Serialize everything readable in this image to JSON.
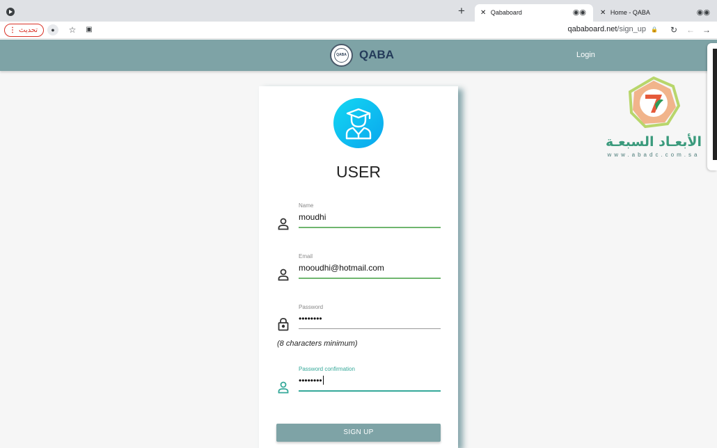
{
  "browser": {
    "new_tab_label": "+",
    "tabs": [
      {
        "close": "✕",
        "title": "Qababoard",
        "active": true
      },
      {
        "close": "✕",
        "title": "Home - QABA",
        "active": false
      }
    ],
    "update_button": "تحديث",
    "url_host": "qababoard.net",
    "url_path": "/sign_up"
  },
  "navbar": {
    "brand_name": "QABA",
    "seal_text": "QABA",
    "login": "Login",
    "color": "#7ea3a6"
  },
  "watermark": {
    "arabic_text": "الأبعـاد السبعـة",
    "url": "www.abadc.com.sa"
  },
  "form": {
    "title": "USER",
    "fields": [
      {
        "label": "Name",
        "value": "moudhi",
        "icon": "person-icon"
      },
      {
        "label": "Email",
        "value": "mooudhi@hotmail.com",
        "icon": "person-icon"
      },
      {
        "label": "Password",
        "value": "••••••••",
        "icon": "lock-icon"
      },
      {
        "label": "Password confirmation",
        "value": "••••••••",
        "icon": "person-icon"
      }
    ],
    "password_hint": "(8 characters minimum)",
    "submit": "SIGN UP"
  }
}
